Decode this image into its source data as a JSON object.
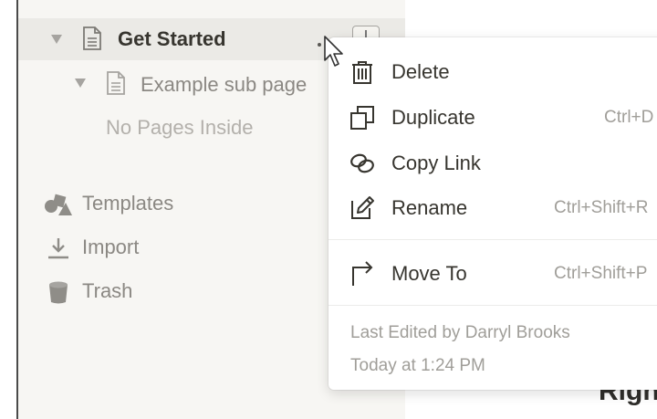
{
  "sidebar": {
    "tree": [
      {
        "label": "Get Started"
      },
      {
        "label": "Example sub page"
      },
      {
        "label": "No Pages Inside"
      }
    ],
    "footer": [
      {
        "label": "Templates",
        "icon": "templates-icon"
      },
      {
        "label": "Import",
        "icon": "import-icon"
      },
      {
        "label": "Trash",
        "icon": "trash-icon"
      }
    ]
  },
  "context_menu": {
    "items": [
      {
        "label": "Delete",
        "shortcut": "",
        "icon": "trash-can-icon"
      },
      {
        "label": "Duplicate",
        "shortcut": "Ctrl+D",
        "icon": "duplicate-icon"
      },
      {
        "label": "Copy Link",
        "shortcut": "",
        "icon": "link-icon"
      },
      {
        "label": "Rename",
        "shortcut": "Ctrl+Shift+R",
        "icon": "pencil-icon"
      },
      {
        "label": "Move To",
        "shortcut": "Ctrl+Shift+P",
        "icon": "move-arrow-icon"
      }
    ],
    "meta": {
      "edited_by": "Last Edited by Darryl Brooks",
      "edited_at": "Today at 1:24 PM"
    }
  },
  "background_heading": "Righ"
}
